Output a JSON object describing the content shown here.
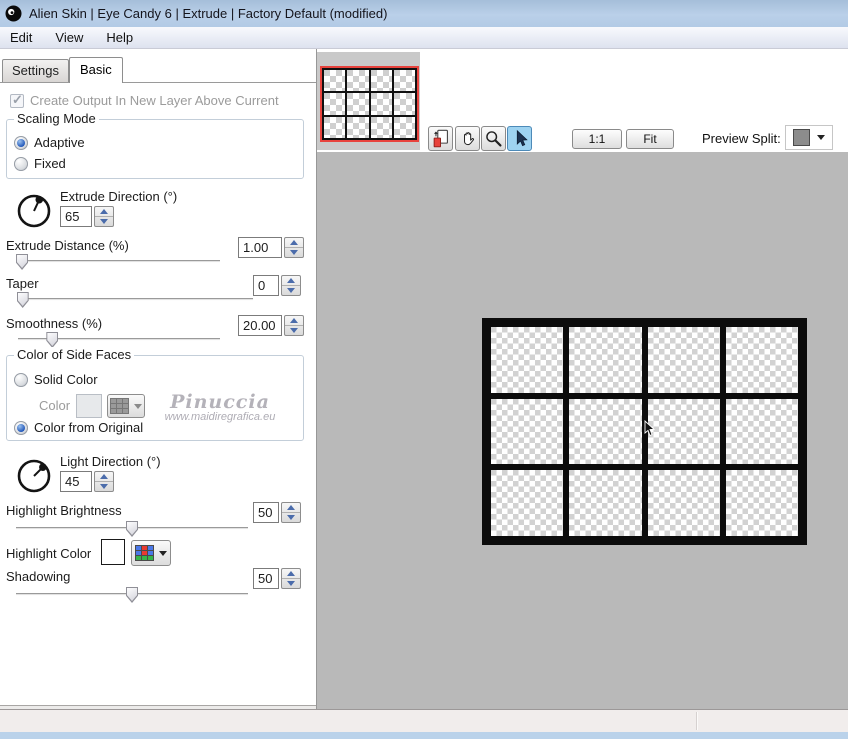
{
  "titlebar": {
    "title": "Alien Skin | Eye Candy 6 | Extrude | Factory Default (modified)"
  },
  "menubar": {
    "items": [
      "Edit",
      "View",
      "Help"
    ]
  },
  "tabs": {
    "settings": "Settings",
    "basic": "Basic",
    "active_tab": "Basic"
  },
  "controls": {
    "create_output": {
      "label": "Create Output In New Layer Above Current",
      "checked": true,
      "disabled": true
    },
    "scaling_mode": {
      "legend": "Scaling Mode",
      "adaptive": {
        "label": "Adaptive",
        "selected": true
      },
      "fixed": {
        "label": "Fixed",
        "selected": false
      }
    },
    "extrude_direction": {
      "label": "Extrude Direction (°)",
      "value": "65",
      "degrees": 65
    },
    "extrude_distance": {
      "label": "Extrude Distance (%)",
      "value": "1.00",
      "slider_percent": 2
    },
    "taper": {
      "label": "Taper",
      "value": "0",
      "slider_percent": 2
    },
    "smoothness": {
      "label": "Smoothness (%)",
      "value": "20.00",
      "slider_percent": 17
    },
    "side_faces": {
      "legend": "Color of Side Faces",
      "solid": {
        "label": "Solid Color",
        "selected": false
      },
      "color_label": "Color",
      "from_original": {
        "label": "Color from Original",
        "selected": true
      }
    },
    "light_direction": {
      "label": "Light Direction (°)",
      "value": "45",
      "degrees": 45
    },
    "highlight_brightness": {
      "label": "Highlight Brightness",
      "value": "50",
      "slider_percent": 50
    },
    "highlight_color": {
      "label": "Highlight Color",
      "swatch_color": "#ffffff"
    },
    "shadowing": {
      "label": "Shadowing",
      "value": "50",
      "slider_percent": 50
    }
  },
  "watermark": {
    "name": "Pinuccia",
    "url": "www.maidiregrafica.eu"
  },
  "preview_toolbar": {
    "actual_size_label": "1:1",
    "fit_label": "Fit",
    "preview_split_label": "Preview Split:",
    "active_tool": "select-tool"
  },
  "colors": {
    "titlebar_blue": "#aec7e2",
    "preview_background": "#b9b9b9",
    "navigator_background": "#c9c9c9",
    "thumbnail_border_red": "#e8433d",
    "tool_active_blue": "#9ed3f1",
    "status_bar": "#f1edec",
    "bottom_strip_blue": "#bad2ea",
    "highlight_swatch": "#ffffff",
    "preview_split_swatch": "#8c8c8c"
  }
}
